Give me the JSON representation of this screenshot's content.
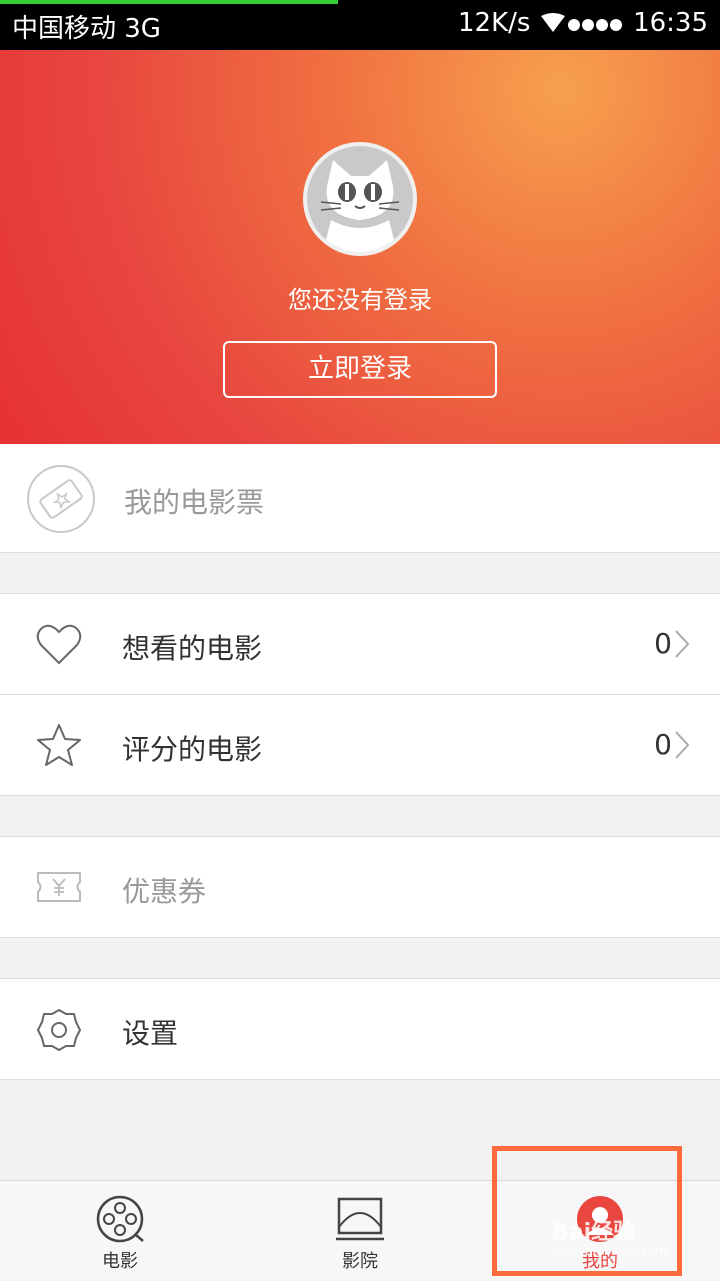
{
  "status_bar": {
    "carrier": "中国移动 3G",
    "speed": "12K/s",
    "time": "16:35"
  },
  "profile": {
    "not_logged_text": "您还没有登录",
    "login_button": "立即登录"
  },
  "menu": {
    "tickets": {
      "label": "我的电影票",
      "icon": "ticket-star-icon"
    },
    "want_to_watch": {
      "label": "想看的电影",
      "count": "0",
      "icon": "heart-icon"
    },
    "rated": {
      "label": "评分的电影",
      "count": "0",
      "icon": "star-icon"
    },
    "coupons": {
      "label": "优惠券",
      "icon": "coupon-yen-icon"
    },
    "settings": {
      "label": "设置",
      "icon": "gear-icon"
    }
  },
  "tabbar": {
    "tabs": [
      {
        "label": "电影",
        "icon": "film-reel-icon"
      },
      {
        "label": "影院",
        "icon": "cinema-screen-icon"
      },
      {
        "label": "我的",
        "icon": "user-icon",
        "active": true
      }
    ]
  },
  "watermark": {
    "brand": "Bai经验",
    "url": "jingyan.baidu.com"
  },
  "colors": {
    "accent": "#e8463f",
    "highlight": "#ff6a3d",
    "status_bar": "#000000"
  }
}
